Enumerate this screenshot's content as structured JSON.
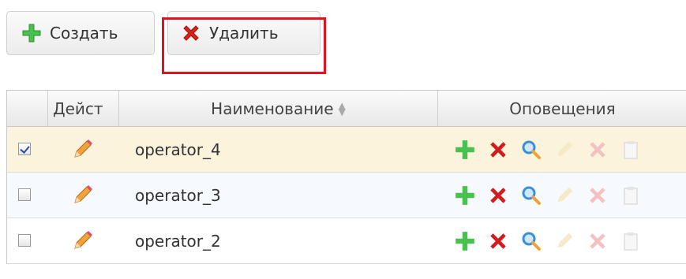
{
  "toolbar": {
    "create_label": "Создать",
    "delete_label": "Удалить"
  },
  "grid": {
    "columns": {
      "actions": "Дейст",
      "name": "Наименование",
      "notifications": "Оповещения"
    },
    "rows": [
      {
        "checked": true,
        "name": "operator_4"
      },
      {
        "checked": false,
        "name": "operator_3"
      },
      {
        "checked": false,
        "name": "operator_2"
      }
    ]
  },
  "icons": {
    "create": "plus-icon",
    "delete": "cross-icon",
    "edit": "pencil-icon",
    "row_actions": [
      "plus-icon",
      "cross-icon",
      "magnifier-icon",
      "pencil-icon",
      "cross-icon",
      "clipboard-icon"
    ]
  },
  "colors": {
    "highlight": "#e0141e",
    "selected_row": "#fbf3dc",
    "plus_green": "#3cb54a",
    "cross_red": "#d01c1c"
  }
}
